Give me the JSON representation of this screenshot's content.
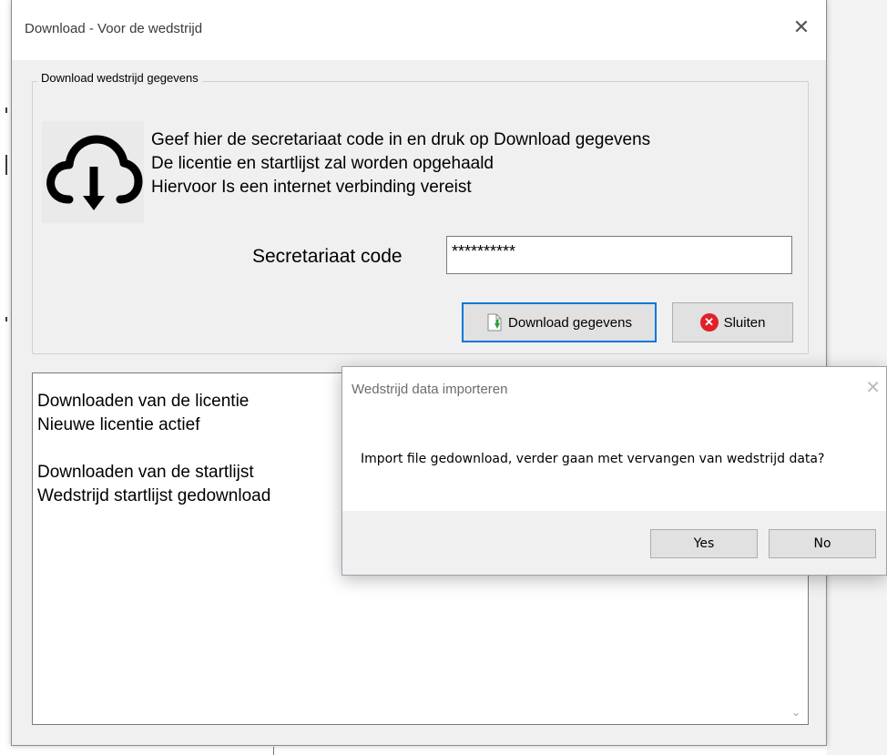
{
  "main_window": {
    "title": "Download - Voor de wedstrijd",
    "close_glyph": "✕",
    "group_label": "Download wedstrijd gegevens",
    "icon": "cloud-download-icon",
    "info_lines": [
      "Geef hier de secretariaat code in en druk op Download gegevens",
      "De licentie en startlijst zal worden opgehaald",
      "Hiervoor Is een internet verbinding vereist"
    ],
    "code_label": "Secretariaat code",
    "code_value": "**********",
    "download_button": "Download gegevens",
    "close_button": "Sluiten",
    "log_lines": [
      "Downloaden van de licentie",
      "Nieuwe licentie actief",
      "",
      "Downloaden van de startlijst",
      "Wedstrijd startlijst gedownload"
    ]
  },
  "dialog": {
    "title": "Wedstrijd data importeren",
    "close_glyph": "✕",
    "message": "Import file gedownload, verder gaan met vervangen van wedstrijd data?",
    "yes_label": "Yes",
    "no_label": "No"
  },
  "colors": {
    "focus_border": "#0078d7",
    "close_red": "#e0202a"
  }
}
